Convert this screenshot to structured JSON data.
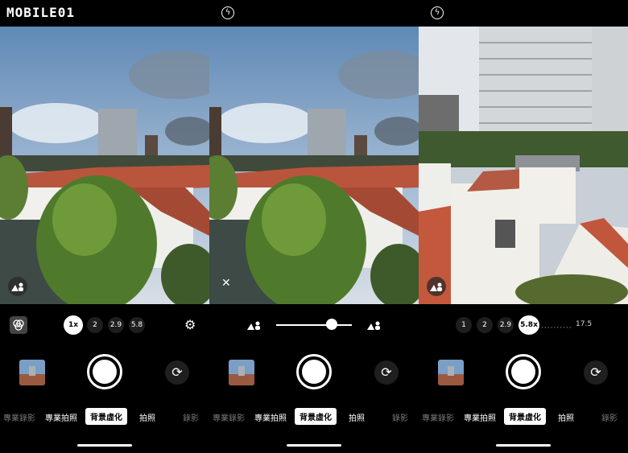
{
  "watermark": "MOBILE01",
  "panels": [
    {
      "zoom_options": [
        "1x",
        "2",
        "2.9",
        "5.8"
      ],
      "active_zoom": "1x",
      "modes": {
        "video_pro": "專業錄影",
        "photo_pro": "專業拍照",
        "bokeh": "背景虛化",
        "photo": "拍照",
        "video": "錄影"
      }
    },
    {
      "modes": {
        "video_pro": "專業錄影",
        "photo_pro": "專業拍照",
        "bokeh": "背景虛化",
        "photo": "拍照",
        "video": "錄影"
      },
      "blur_level": 0.74
    },
    {
      "zoom_options": [
        "1",
        "2",
        "2.9",
        "5.8x"
      ],
      "active_zoom": "5.8x",
      "zoom_max": "17.5",
      "modes": {
        "video_pro": "專業錄影",
        "photo_pro": "專業拍照",
        "bokeh": "背景虛化",
        "photo": "拍照",
        "video": "錄影"
      }
    }
  ],
  "icons": {
    "flash": "flash-off-icon",
    "portrait": "portrait-blur-icon",
    "gear": "gear-icon",
    "flip": "flip-camera-icon",
    "close": "close-icon",
    "filter": "filter-icon"
  },
  "colors": {
    "accent": "#ffffff",
    "background": "#000000"
  }
}
